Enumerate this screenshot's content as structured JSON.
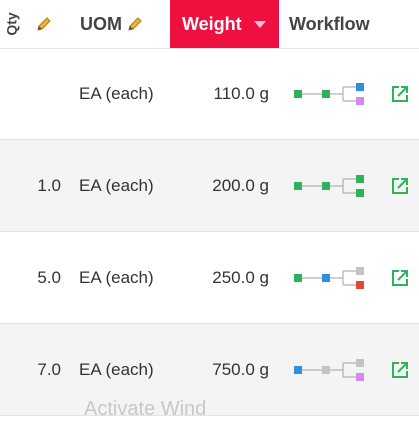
{
  "header": {
    "qty_label": "Qty",
    "uom_label": "UOM",
    "weight_label": "Weight",
    "workflow_label": "Workflow"
  },
  "rows": [
    {
      "qty": "",
      "uom": "EA (each)",
      "weight": "110.0 g",
      "workflow": [
        "#2db35d",
        "#2db35d",
        "#2f8fd8",
        "#d38af0"
      ]
    },
    {
      "qty": "1.0",
      "uom": "EA (each)",
      "weight": "200.0 g",
      "workflow": [
        "#2db35d",
        "#2db35d",
        "#2db35d",
        "#2db35d"
      ]
    },
    {
      "qty": "5.0",
      "uom": "EA (each)",
      "weight": "250.0 g",
      "workflow": [
        "#2db35d",
        "#2f8fd8",
        "#c4c4c4",
        "#e0483b"
      ]
    },
    {
      "qty": "7.0",
      "uom": "EA (each)",
      "weight": "750.0 g",
      "workflow": [
        "#2f8fd8",
        "#c4c4c4",
        "#c4c4c4",
        "#d38af0"
      ]
    }
  ],
  "footer_text": "Activate Wind",
  "colors": {
    "accent": "#f0103f",
    "edit_icon": "#2db35d",
    "connector": "#b0b0b0"
  }
}
